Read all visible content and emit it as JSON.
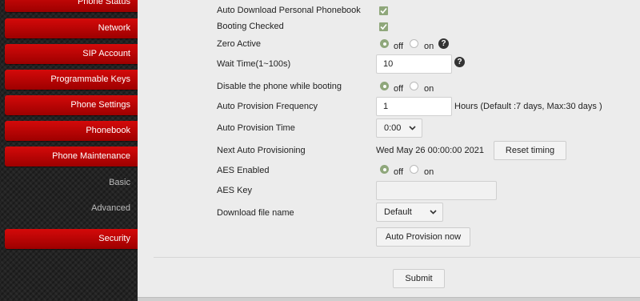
{
  "sidebar": {
    "items": [
      {
        "label": "Phone Status"
      },
      {
        "label": "Network"
      },
      {
        "label": "SIP Account"
      },
      {
        "label": "Programmable Keys"
      },
      {
        "label": "Phone Settings"
      },
      {
        "label": "Phonebook"
      },
      {
        "label": "Phone Maintenance"
      }
    ],
    "subitems": [
      {
        "label": "Basic"
      },
      {
        "label": "Advanced"
      }
    ],
    "security": {
      "label": "Security"
    }
  },
  "form": {
    "auto_download_phonebook": {
      "label": "Auto Download Personal Phonebook",
      "checked": true
    },
    "booting_checked": {
      "label": "Booting Checked",
      "checked": true
    },
    "zero_active": {
      "label": "Zero Active",
      "off": "off",
      "on": "on",
      "selected": "off"
    },
    "wait_time": {
      "label": "Wait Time(1~100s)",
      "value": "10"
    },
    "disable_phone_booting": {
      "label": "Disable the phone while booting",
      "off": "off",
      "on": "on",
      "selected": "off"
    },
    "auto_provision_frequency": {
      "label": "Auto Provision Frequency",
      "value": "1",
      "unit_hint": "Hours (Default :7 days, Max:30 days )"
    },
    "auto_provision_time": {
      "label": "Auto Provision Time",
      "value": "0:00"
    },
    "next_auto_provisioning": {
      "label": "Next Auto Provisioning",
      "value": "Wed May 26 00:00:00 2021",
      "reset_label": "Reset timing"
    },
    "aes_enabled": {
      "label": "AES Enabled",
      "off": "off",
      "on": "on",
      "selected": "off"
    },
    "aes_key": {
      "label": "AES Key",
      "value": ""
    },
    "download_file_name": {
      "label": "Download file name",
      "value": "Default"
    },
    "auto_provision_now_label": "Auto Provision now",
    "submit_label": "Submit"
  },
  "colors": {
    "accent_red": "#c00000",
    "check_green": "#8fa77b"
  },
  "icons": {
    "help": "question-circle-icon",
    "chevron": "chevron-down-icon",
    "check": "check-icon"
  }
}
